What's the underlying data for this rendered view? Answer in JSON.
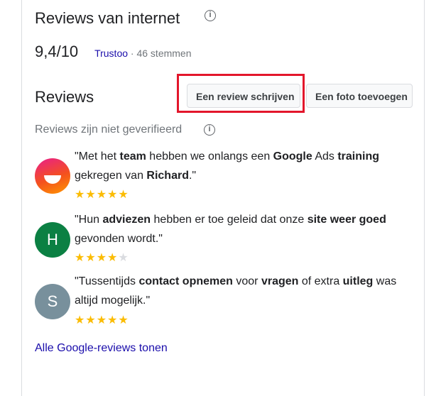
{
  "header": {
    "title": "Reviews van internet",
    "score": "9,4/10",
    "source": "Trustoo",
    "votes": " · 46 stemmen"
  },
  "reviews_section": {
    "title": "Reviews",
    "write_button": "Een review schrijven",
    "photo_button": "Een foto toevoegen",
    "unverified_note": "Reviews zijn niet geverifieerd"
  },
  "reviews": [
    {
      "avatar_letter": "",
      "avatar_color": "#f4511e",
      "segments": [
        {
          "t": "\"Met het ",
          "b": false
        },
        {
          "t": "team",
          "b": true
        },
        {
          "t": " hebben we onlangs een ",
          "b": false
        },
        {
          "t": "Google",
          "b": true
        },
        {
          "t": " Ads ",
          "b": false
        },
        {
          "t": "training",
          "b": true
        },
        {
          "t": " gekregen van ",
          "b": false
        },
        {
          "t": "Richard",
          "b": true
        },
        {
          "t": ".\"",
          "b": false
        }
      ],
      "rating": 5
    },
    {
      "avatar_letter": "H",
      "avatar_color": "#0b8043",
      "segments": [
        {
          "t": "\"Hun ",
          "b": false
        },
        {
          "t": "adviezen",
          "b": true
        },
        {
          "t": " hebben er toe geleid dat onze ",
          "b": false
        },
        {
          "t": "site weer goed",
          "b": true
        },
        {
          "t": " gevonden wordt.\"",
          "b": false
        }
      ],
      "rating": 4
    },
    {
      "avatar_letter": "S",
      "avatar_color": "#78909c",
      "segments": [
        {
          "t": "\"Tussentijds ",
          "b": false
        },
        {
          "t": "contact opnemen",
          "b": true
        },
        {
          "t": " voor ",
          "b": false
        },
        {
          "t": "vragen",
          "b": true
        },
        {
          "t": " of extra ",
          "b": false
        },
        {
          "t": "uitleg",
          "b": true
        },
        {
          "t": " was altijd mogelijk.\"",
          "b": false
        }
      ],
      "rating": 5
    }
  ],
  "footer": {
    "all_reviews_link": "Alle Google-reviews tonen"
  },
  "colors": {
    "link": "#1a0dab",
    "star": "#fbbc04",
    "highlight": "#e3162b"
  },
  "icons": [
    "info-icon",
    "star-icon"
  ]
}
